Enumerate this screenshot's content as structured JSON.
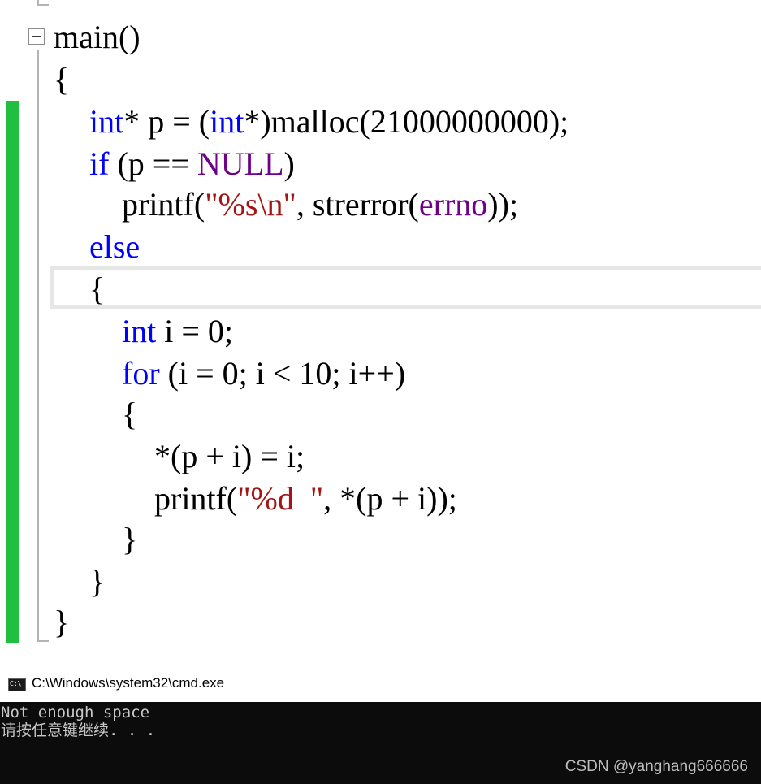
{
  "editor": {
    "lines": [
      [
        {
          "t": "main()",
          "c": ""
        }
      ],
      [
        {
          "t": "{",
          "c": ""
        }
      ],
      [
        {
          "t": "    ",
          "c": ""
        },
        {
          "t": "int",
          "c": "kw"
        },
        {
          "t": "* p = (",
          "c": ""
        },
        {
          "t": "int",
          "c": "kw"
        },
        {
          "t": "*)malloc(21000000000);",
          "c": ""
        }
      ],
      [
        {
          "t": "    ",
          "c": ""
        },
        {
          "t": "if",
          "c": "kw"
        },
        {
          "t": " (p == ",
          "c": ""
        },
        {
          "t": "NULL",
          "c": "mac"
        },
        {
          "t": ")",
          "c": ""
        }
      ],
      [
        {
          "t": "        printf(",
          "c": ""
        },
        {
          "t": "\"%s\\n\"",
          "c": "str"
        },
        {
          "t": ", strerror(",
          "c": ""
        },
        {
          "t": "errno",
          "c": "mac"
        },
        {
          "t": "));",
          "c": ""
        }
      ],
      [
        {
          "t": "    ",
          "c": ""
        },
        {
          "t": "else",
          "c": "kw"
        }
      ],
      [
        {
          "t": "    {",
          "c": ""
        }
      ],
      [
        {
          "t": "        ",
          "c": ""
        },
        {
          "t": "int",
          "c": "kw"
        },
        {
          "t": " i = 0;",
          "c": ""
        }
      ],
      [
        {
          "t": "        ",
          "c": ""
        },
        {
          "t": "for",
          "c": "kw"
        },
        {
          "t": " (i = 0; i < 10; i++)",
          "c": ""
        }
      ],
      [
        {
          "t": "        {",
          "c": ""
        }
      ],
      [
        {
          "t": "            *(p + i) = i;",
          "c": ""
        }
      ],
      [
        {
          "t": "            printf(",
          "c": ""
        },
        {
          "t": "\"%d  \"",
          "c": "str"
        },
        {
          "t": ", *(p + i));",
          "c": ""
        }
      ],
      [
        {
          "t": "        }",
          "c": ""
        }
      ],
      [
        {
          "t": "    }",
          "c": ""
        }
      ],
      [
        {
          "t": "}",
          "c": ""
        }
      ]
    ]
  },
  "console": {
    "title": "C:\\Windows\\system32\\cmd.exe",
    "output": [
      "Not enough space",
      "请按任意键继续. . ."
    ]
  },
  "watermark": "CSDN @yanghang666666",
  "colors": {
    "keyword": "#0000ff",
    "macro": "#6f008a",
    "string": "#a31515",
    "change_bar": "#1fbf3f",
    "terminal_bg": "#0c0c0c"
  }
}
